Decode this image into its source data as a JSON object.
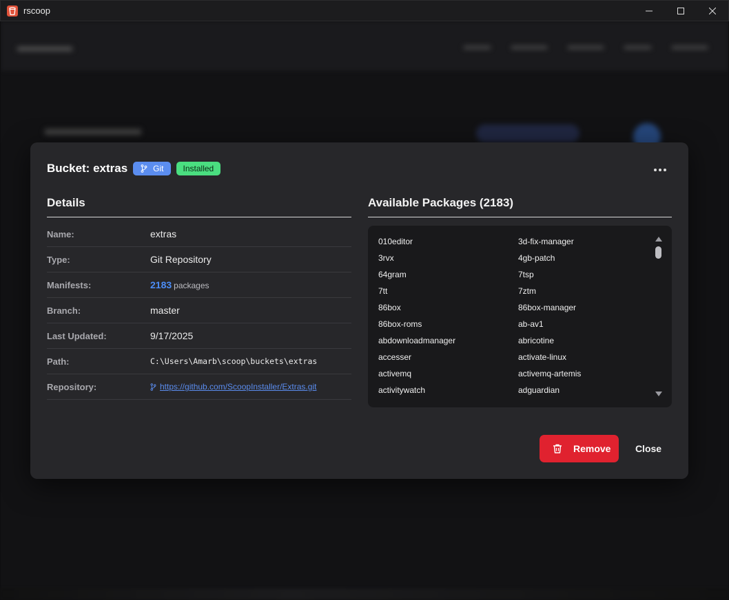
{
  "window": {
    "title": "rscoop",
    "controls": {
      "minimize": "—",
      "maximize": "☐",
      "close": "✕"
    }
  },
  "modal": {
    "title": "Bucket: extras",
    "badges": {
      "git": "Git",
      "installed": "Installed"
    },
    "details": {
      "heading": "Details",
      "rows": [
        {
          "label": "Name:",
          "value": "extras"
        },
        {
          "label": "Type:",
          "value": "Git Repository"
        },
        {
          "label": "Manifests:",
          "count": "2183",
          "unit": "packages"
        },
        {
          "label": "Branch:",
          "value": "master"
        },
        {
          "label": "Last Updated:",
          "value": "9/17/2025"
        },
        {
          "label": "Path:",
          "value": "C:\\Users\\Amarb\\scoop\\buckets\\extras"
        },
        {
          "label": "Repository:",
          "value": "https://github.com/ScoopInstaller/Extras.git"
        }
      ]
    },
    "packages": {
      "heading": "Available Packages (2183)",
      "items": [
        "010editor",
        "3d-fix-manager",
        "3rvx",
        "4gb-patch",
        "64gram",
        "7tsp",
        "7tt",
        "7ztm",
        "86box",
        "86box-manager",
        "86box-roms",
        "ab-av1",
        "abdownloadmanager",
        "abricotine",
        "accesser",
        "activate-linux",
        "activemq",
        "activemq-artemis",
        "activitywatch",
        "adguardian"
      ]
    },
    "actions": {
      "remove": "Remove",
      "close": "Close"
    }
  },
  "colors": {
    "accent": "#5b8def",
    "installed": "#4ade80",
    "danger": "#e0222f",
    "link": "#4c8df6"
  }
}
